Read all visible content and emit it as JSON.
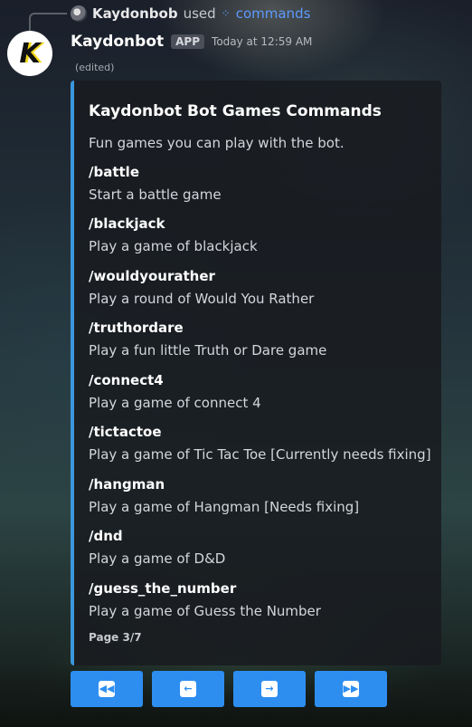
{
  "reply": {
    "user": "Kaydonbob",
    "used": "used",
    "command": "commands"
  },
  "message": {
    "author": "Kaydonbot",
    "badge": "APP",
    "timestamp": "Today at 12:59 AM",
    "edited": "(edited)"
  },
  "embed": {
    "accent_color": "#3b97dc",
    "title": "Kaydonbot Bot Games Commands",
    "description": "Fun games you can play with the bot.",
    "fields": [
      {
        "name": "/battle",
        "value": "Start a battle game"
      },
      {
        "name": "/blackjack",
        "value": "Play a game of blackjack"
      },
      {
        "name": "/wouldyourather",
        "value": "Play a round of Would You Rather"
      },
      {
        "name": "/truthordare",
        "value": "Play a fun little Truth or Dare game"
      },
      {
        "name": "/connect4",
        "value": "Play a game of connect 4"
      },
      {
        "name": "/tictactoe",
        "value": "Play a game of Tic Tac Toe [Currently needs fixing]"
      },
      {
        "name": "/hangman",
        "value": "Play a game of Hangman [Needs fixing]"
      },
      {
        "name": "/dnd",
        "value": "Play a game of D&D"
      },
      {
        "name": "/guess_the_number",
        "value": "Play a game of Guess the Number"
      }
    ],
    "footer": "Page 3/7"
  },
  "buttons": [
    {
      "icon": "first-page-icon",
      "glyph": "⏪"
    },
    {
      "icon": "previous-page-icon",
      "glyph": "⬅"
    },
    {
      "icon": "next-page-icon",
      "glyph": "➡"
    },
    {
      "icon": "last-page-icon",
      "glyph": "⏩"
    }
  ],
  "colors": {
    "button": "#2d8ef0",
    "link": "#5c9aff"
  }
}
